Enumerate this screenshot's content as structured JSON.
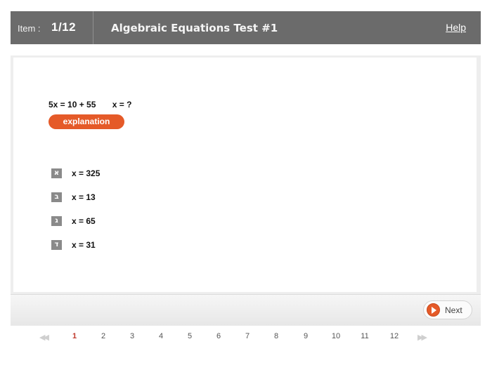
{
  "header": {
    "item_label": "Item :",
    "item_value": "1/12",
    "title": "Algebraic Equations Test #1",
    "help": "Help"
  },
  "question": {
    "equation": "5x = 10 + 55",
    "ask": "x = ?",
    "explanation_label": "explanation"
  },
  "answers": [
    {
      "letter": "א",
      "text": "x = 325"
    },
    {
      "letter": "ב",
      "text": "x = 13"
    },
    {
      "letter": "ג",
      "text": "x = 65"
    },
    {
      "letter": "ד",
      "text": "x = 31"
    }
  ],
  "footer": {
    "next_label": "Next"
  },
  "pager": {
    "pages": [
      "1",
      "2",
      "3",
      "4",
      "5",
      "6",
      "7",
      "8",
      "9",
      "10",
      "11",
      "12"
    ],
    "current": "1",
    "prev_icon": "double-chevron-left-icon",
    "next_icon": "double-chevron-right-icon"
  },
  "colors": {
    "header_bg": "#6b6b6b",
    "accent": "#e55a28",
    "active_page": "#c0392b"
  }
}
